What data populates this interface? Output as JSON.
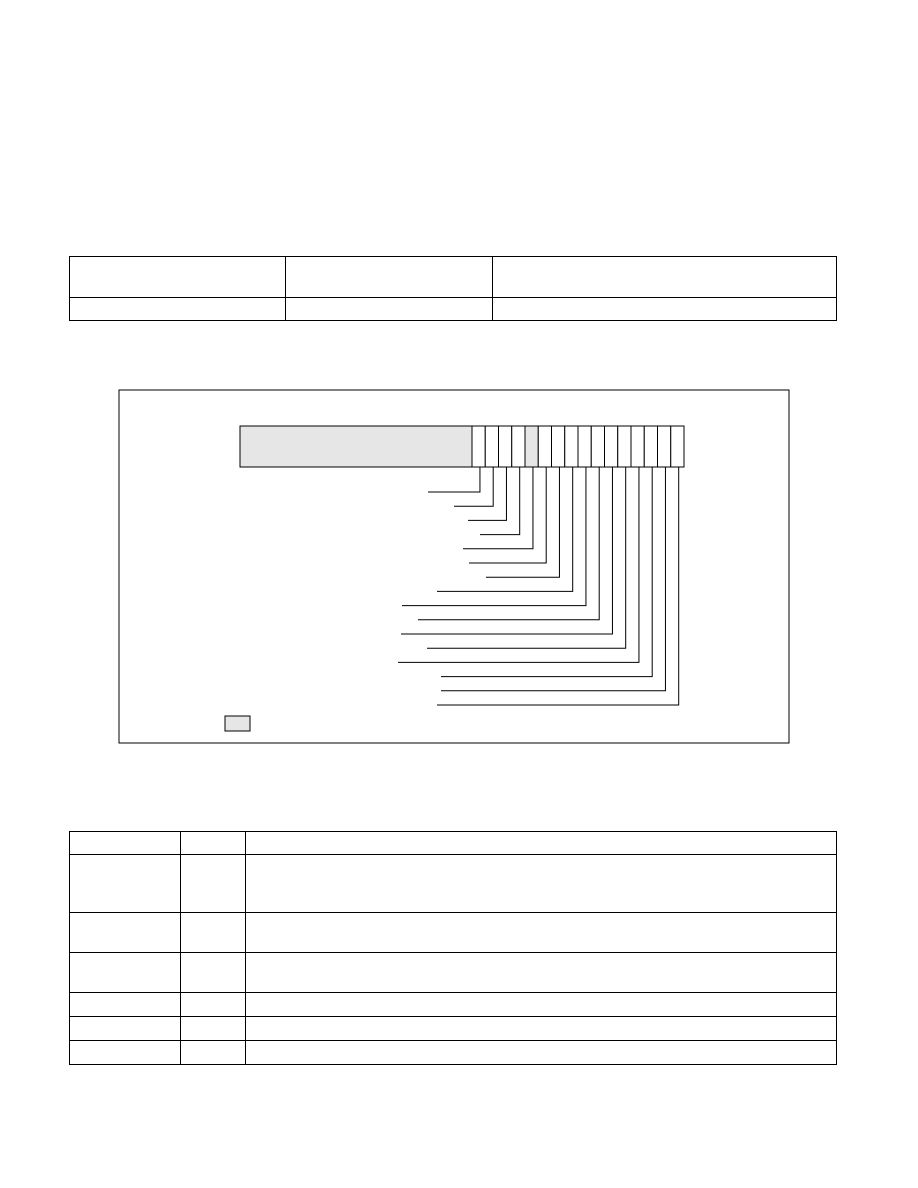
{
  "document": {
    "top_table": {
      "rows": [
        [
          "",
          "",
          ""
        ],
        [
          "",
          "",
          ""
        ]
      ]
    },
    "register_figure": {
      "field_count": 16,
      "shaded_field_indices": [
        4
      ],
      "legend_label": ""
    },
    "bottom_table": {
      "rows": [
        [
          "",
          "",
          ""
        ],
        [
          "",
          "",
          ""
        ],
        [
          "",
          "",
          ""
        ],
        [
          "",
          "",
          ""
        ],
        [
          "",
          "",
          ""
        ],
        [
          "",
          "",
          ""
        ],
        [
          "",
          "",
          ""
        ]
      ]
    }
  }
}
